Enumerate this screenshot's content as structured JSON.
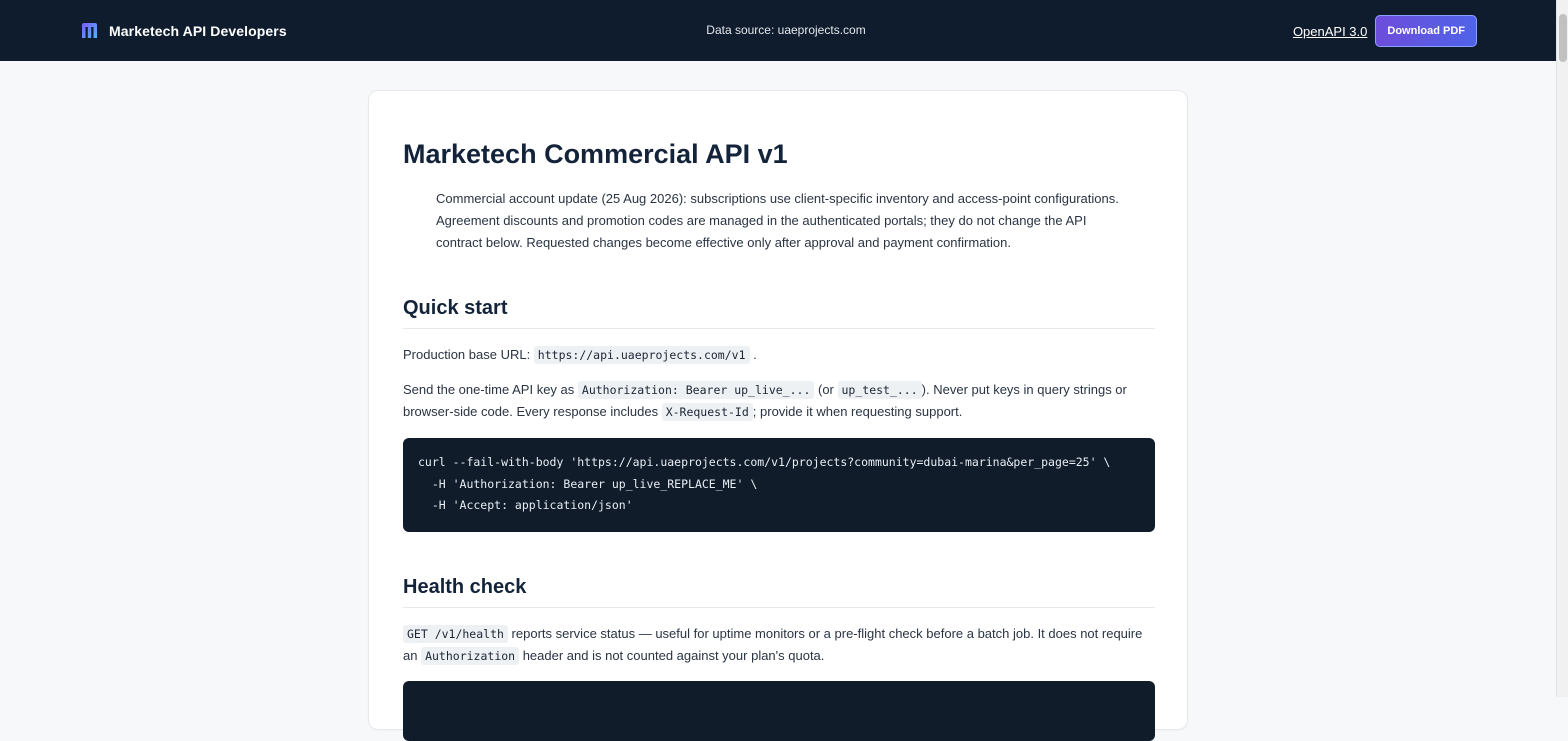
{
  "header": {
    "brand": "Marketech API Developers",
    "data_source": "Data source: uaeprojects.com",
    "openapi_link": "OpenAPI 3.0",
    "download_button": "Download PDF",
    "brand_icon": "m-logo-icon"
  },
  "colors": {
    "topbar": "#0f1c2e",
    "button_gradient_start": "#6d4ddb",
    "button_gradient_end": "#4f63e8",
    "code_bg": "#111c2b"
  },
  "page": {
    "title": "Marketech Commercial API v1",
    "notice": "Commercial account update (25 Aug 2026): subscriptions use client-specific inventory and access-point configurations. Agreement discounts and promotion codes are managed in the authenticated portals; they do not change the API contract below. Requested changes become effective only after approval and payment confirmation."
  },
  "quick_start": {
    "heading": "Quick start",
    "base_url_label": "Production base URL: ",
    "base_url": "https://api.uaeprojects.com/v1",
    "base_url_suffix": ".",
    "auth_1": "Send the one-time API key as ",
    "auth_code_1": "Authorization: Bearer up_live_...",
    "auth_2": " (or ",
    "auth_code_2": "up_test_...",
    "auth_3": "). Never put keys in query strings or browser-side code. Every response includes ",
    "auth_code_3": "X-Request-Id",
    "auth_4": "; provide it when requesting support.",
    "code": "curl --fail-with-body 'https://api.uaeprojects.com/v1/projects?community=dubai-marina&per_page=25' \\\n  -H 'Authorization: Bearer up_live_REPLACE_ME' \\\n  -H 'Accept: application/json'"
  },
  "health_check": {
    "heading": "Health check",
    "code_1": "GET /v1/health",
    "text_1": " reports service status — useful for uptime monitors or a pre-flight check before a batch job. It does not require an ",
    "code_2": "Authorization",
    "text_2": " header and is not counted against your plan's quota."
  }
}
